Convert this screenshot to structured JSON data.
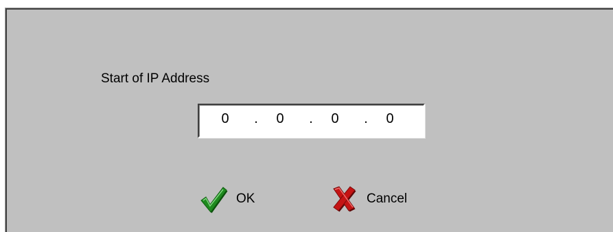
{
  "dialog": {
    "label": "Start of IP Address",
    "ip": {
      "octet1": "0",
      "octet2": "0",
      "octet3": "0",
      "octet4": "0",
      "separator": "."
    },
    "ok_button": {
      "label": "OK",
      "icon": "checkmark-icon",
      "icon_color": "#1f8a1f"
    },
    "cancel_button": {
      "label": "Cancel",
      "icon": "x-mark-icon",
      "icon_color": "#c41414"
    }
  },
  "colors": {
    "dialog_background": "#c0c0c0",
    "field_background": "#ffffff"
  }
}
